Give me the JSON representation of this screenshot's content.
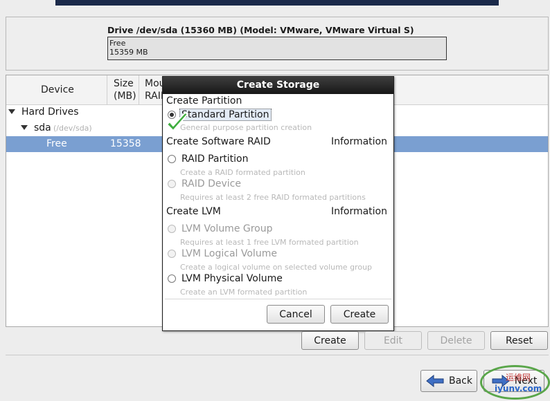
{
  "drive": {
    "title": "Drive /dev/sda (15360 MB) (Model: VMware, VMware Virtual S)",
    "bar_label": "Free",
    "bar_size": "15359 MB"
  },
  "tree": {
    "headers": {
      "device": "Device",
      "size_line1": "Size",
      "size_line2": "(MB)",
      "mount_line1": "Mou",
      "mount_line2": "RAID"
    },
    "rows": {
      "hard_drives": "Hard Drives",
      "sda": "sda",
      "sda_path": "(/dev/sda)",
      "free_label": "Free",
      "free_size": "15358"
    }
  },
  "dialog": {
    "title": "Create Storage",
    "partition_section": "Create Partition",
    "standard_partition": "Standard Partition",
    "standard_desc": "General purpose partition creation",
    "raid_section": "Create Software RAID",
    "raid_info": "Information",
    "raid_partition": "RAID Partition",
    "raid_partition_desc": "Create a RAID formated partition",
    "raid_device": "RAID Device",
    "raid_device_desc": "Requires at least 2 free RAID formated partitions",
    "lvm_section": "Create LVM",
    "lvm_info": "Information",
    "lvm_vg": "LVM Volume Group",
    "lvm_vg_desc": "Requires at least 1 free LVM formated partition",
    "lvm_lv": "LVM Logical Volume",
    "lvm_lv_desc": "Create a logical volume on selected volume group",
    "lvm_pv": "LVM Physical Volume",
    "lvm_pv_desc": "Create an LVM formated partition",
    "cancel": "Cancel",
    "create": "Create"
  },
  "actions": {
    "create": "Create",
    "edit": "Edit",
    "delete": "Delete",
    "reset": "Reset"
  },
  "nav": {
    "back": "Back",
    "next": "Next"
  },
  "watermark": {
    "top": "运维网",
    "bottom": "iyunv.com"
  },
  "colors": {
    "selection": "#7a9fd1",
    "check": "#3fae3f",
    "watermark_ring": "#5aa64a"
  }
}
